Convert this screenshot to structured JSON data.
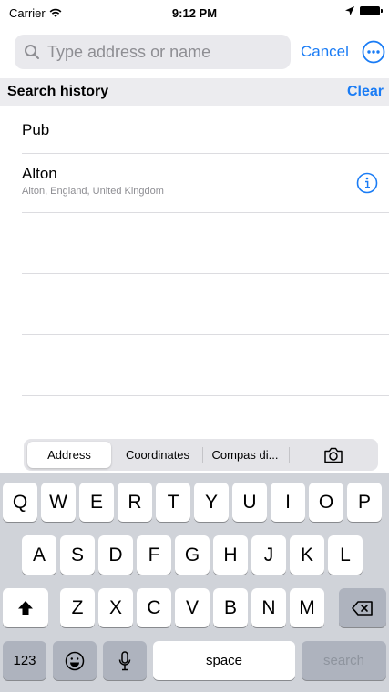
{
  "status": {
    "carrier": "Carrier",
    "time": "9:12 PM"
  },
  "search": {
    "placeholder": "Type address or name",
    "cancel": "Cancel"
  },
  "history": {
    "title": "Search history",
    "clear": "Clear",
    "items": [
      {
        "name": "Pub",
        "detail": ""
      },
      {
        "name": "Alton",
        "detail": "Alton, England, United Kingdom"
      }
    ]
  },
  "segments": {
    "options": [
      "Address",
      "Coordinates",
      "Compas di..."
    ],
    "selected": "Address"
  },
  "keyboard": {
    "row1": [
      "Q",
      "W",
      "E",
      "R",
      "T",
      "Y",
      "U",
      "I",
      "O",
      "P"
    ],
    "row2": [
      "A",
      "S",
      "D",
      "F",
      "G",
      "H",
      "J",
      "K",
      "L"
    ],
    "row3": [
      "Z",
      "X",
      "C",
      "V",
      "B",
      "N",
      "M"
    ],
    "numbers": "123",
    "space": "space",
    "search": "search"
  },
  "colors": {
    "accent": "#1a7cf5",
    "keyboard_bg": "#d0d3d9"
  }
}
